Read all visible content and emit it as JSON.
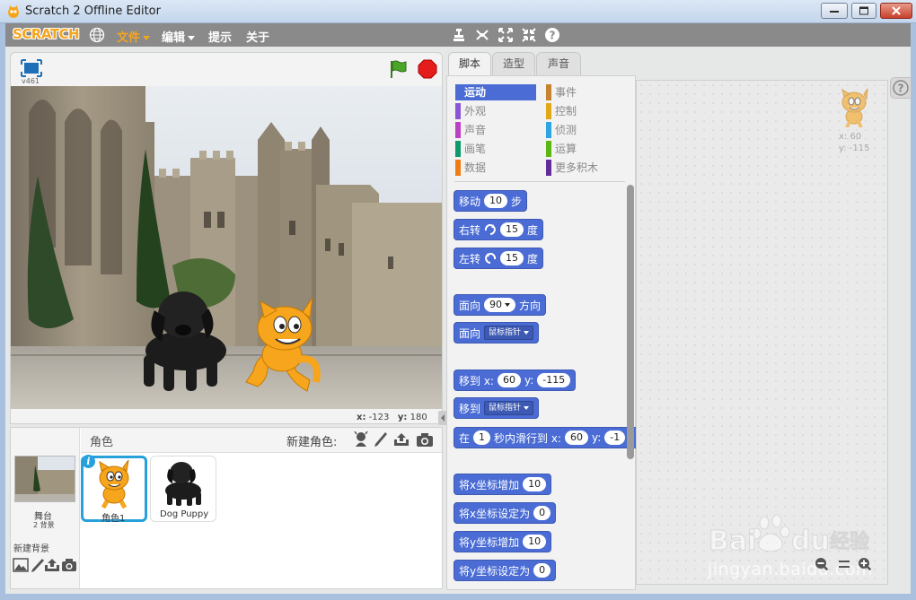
{
  "window": {
    "title": "Scratch 2 Offline Editor"
  },
  "menubar": {
    "logo": "SCRATCH",
    "items": [
      {
        "label": "文件",
        "active": true,
        "has_caret": true
      },
      {
        "label": "编辑",
        "active": false,
        "has_caret": true
      },
      {
        "label": "提示",
        "active": false,
        "has_caret": false
      },
      {
        "label": "关于",
        "active": false,
        "has_caret": false
      }
    ],
    "tools": [
      "duplicate-icon",
      "delete-icon",
      "grow-icon",
      "shrink-icon",
      "help-icon"
    ]
  },
  "stage": {
    "version": "v461",
    "mouse_x_label": "x:",
    "mouse_x": "-123",
    "mouse_y_label": "y:",
    "mouse_y": "180"
  },
  "sprites": {
    "header": "角色",
    "new_sprite_label": "新建角色:",
    "stage_name": "舞台",
    "backdrop_count": "2 背景",
    "new_backdrop_label": "新建背景",
    "list": [
      {
        "name": "角色1",
        "selected": true
      },
      {
        "name": "Dog Puppy",
        "selected": false
      }
    ]
  },
  "tabs": [
    {
      "label": "脚本",
      "active": true
    },
    {
      "label": "造型",
      "active": false
    },
    {
      "label": "声音",
      "active": false
    }
  ],
  "categories": [
    {
      "label": "运动",
      "color": "#4a6cd4",
      "active": true
    },
    {
      "label": "事件",
      "color": "#c88330",
      "active": false
    },
    {
      "label": "外观",
      "color": "#8a55d7",
      "active": false
    },
    {
      "label": "控制",
      "color": "#e1a91a",
      "active": false
    },
    {
      "label": "声音",
      "color": "#bb42c3",
      "active": false
    },
    {
      "label": "侦测",
      "color": "#2ca5e2",
      "active": false
    },
    {
      "label": "画笔",
      "color": "#0e9a6c",
      "active": false
    },
    {
      "label": "运算",
      "color": "#5cb712",
      "active": false
    },
    {
      "label": "数据",
      "color": "#ee7d16",
      "active": false
    },
    {
      "label": "更多积木",
      "color": "#632d99",
      "active": false
    }
  ],
  "blocks": {
    "move": {
      "text": "移动",
      "value": "10",
      "suffix": "步"
    },
    "turn_right": {
      "text": "右转",
      "value": "15",
      "suffix": "度"
    },
    "turn_left": {
      "text": "左转",
      "value": "15",
      "suffix": "度"
    },
    "point_dir": {
      "text": "面向",
      "value": "90",
      "suffix": "方向"
    },
    "point_towards": {
      "text": "面向",
      "value": "鼠标指针"
    },
    "goto_xy": {
      "text": "移到 x:",
      "x": "60",
      "y_label": "y:",
      "y": "-115"
    },
    "goto": {
      "text": "移到",
      "value": "鼠标指针"
    },
    "glide": {
      "text": "在",
      "secs": "1",
      "mid": "秒内滑行到 x:",
      "x": "60",
      "y_label": "y:",
      "y": "-1"
    },
    "change_x": {
      "text": "将x坐标增加",
      "value": "10"
    },
    "set_x": {
      "text": "将x坐标设定为",
      "value": "0"
    },
    "change_y": {
      "text": "将y坐标增加",
      "value": "10"
    },
    "set_y": {
      "text": "将y坐标设定为",
      "value": "0"
    }
  },
  "script_area": {
    "sprite_x": "x: 60",
    "sprite_y": "y: -115"
  },
  "watermark": {
    "url": "jingyan.baidu.com"
  }
}
